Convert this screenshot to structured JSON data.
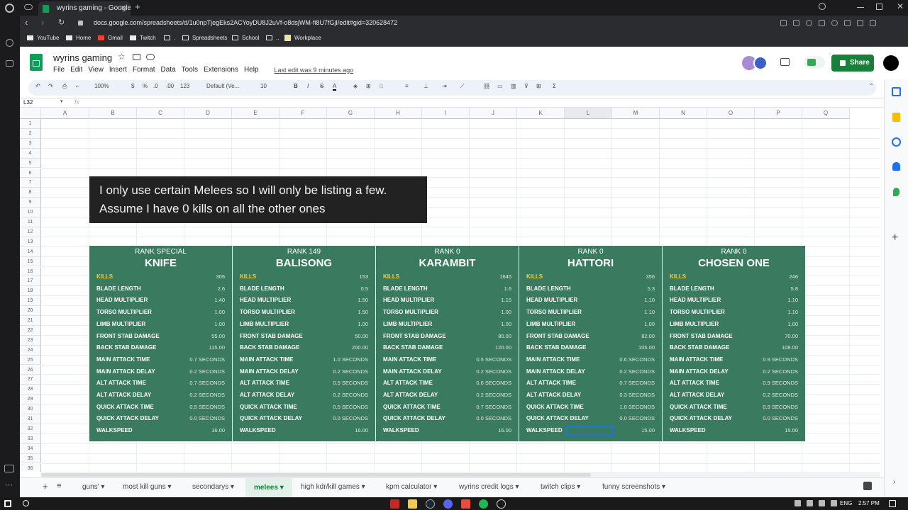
{
  "browser": {
    "tab_title": "wyrins gaming - Google Sh",
    "close_glyph": "✕",
    "new_tab_glyph": "+",
    "url": "docs.google.com/spreadsheets/d/1u0npTjegEks2ACYoyDU8J2uVf-o8dsjWM-fi8U7fGjI/edit#gid=320628472",
    "bookmarks": [
      "YouTube",
      "Home",
      "Gmail",
      "Twitch",
      ".",
      "Spreadsheets",
      "School",
      "..",
      "Workplace"
    ]
  },
  "sheets": {
    "doc_title": "wyrins gaming",
    "menus": [
      "File",
      "Edit",
      "View",
      "Insert",
      "Format",
      "Data",
      "Tools",
      "Extensions",
      "Help"
    ],
    "last_edit": "Last edit was 9 minutes ago",
    "share_label": "Share",
    "toolbar": {
      "zoom": "100%",
      "currency": "$",
      "percent": "%",
      "dec_less": ".0",
      "dec_more": ".00",
      "num_format": "123",
      "font": "Default (Ve...",
      "font_size": "10",
      "bold": "B",
      "italic": "I",
      "strike": "S",
      "text_color": "A"
    },
    "name_box": "L32",
    "fx": "fx",
    "columns": [
      "A",
      "B",
      "C",
      "D",
      "E",
      "F",
      "G",
      "H",
      "I",
      "J",
      "K",
      "L",
      "M",
      "N",
      "O",
      "P",
      "Q"
    ],
    "rows": [
      "1",
      "2",
      "3",
      "4",
      "5",
      "6",
      "7",
      "8",
      "9",
      "10",
      "11",
      "12",
      "13",
      "14",
      "15",
      "16",
      "17",
      "18",
      "19",
      "20",
      "21",
      "22",
      "23",
      "24",
      "25",
      "26",
      "27",
      "28",
      "29",
      "30",
      "31",
      "32",
      "33",
      "34",
      "35",
      "36"
    ],
    "note_line1": "I only use certain Melees so I will only be listing a few.",
    "note_line2": "Assume I have 0 kills on all the other ones",
    "sheet_tabs": [
      "guns'",
      "most kill guns",
      "secondarys",
      "melees",
      "high kdr/kill games",
      "kpm calculator",
      "wyrins credit logs",
      "twitch clips",
      "funny screenshots"
    ],
    "active_tab": "melees"
  },
  "stat_labels": [
    "KILLS",
    "BLADE LENGTH",
    "HEAD MULTIPLIER",
    "TORSO MULTIPLIER",
    "LIMB MULTIPLIER",
    "FRONT STAB DAMAGE",
    "BACK STAB DAMAGE",
    "MAIN ATTACK TIME",
    "MAIN ATTACK DELAY",
    "ALT ATTACK TIME",
    "ALT ATTACK DELAY",
    "QUICK ATTACK TIME",
    "QUICK ATTACK DELAY",
    "WALKSPEED"
  ],
  "melees": [
    {
      "rank": "RANK SPECIAL",
      "name": "KNIFE",
      "values": [
        "306",
        "2.6",
        "1.40",
        "1.00",
        "1.00",
        "55.00",
        "115.00",
        "0.7 SECONDS",
        "0.2 SECONDS",
        "0.7 SECONDS",
        "0.2 SECONDS",
        "0.5 SECONDS",
        "0.0 SECONDS",
        "16.00"
      ]
    },
    {
      "rank": "RANK 149",
      "name": "BALISONG",
      "values": [
        "153",
        "0.5",
        "1.50",
        "1.50",
        "1.00",
        "50.00",
        "200.00",
        "1.0 SECONDS",
        "0.2 SECONDS",
        "0.5 SECONDS",
        "0.2 SECONDS",
        "0.5 SECONDS",
        "0.0 SECONDS",
        "16.00"
      ]
    },
    {
      "rank": "RANK 0",
      "name": "KARAMBIT",
      "values": [
        "1645",
        "1.6",
        "1.15",
        "1.00",
        "1.00",
        "80.00",
        "120.00",
        "0.5 SECONDS",
        "0.2 SECONDS",
        "0.6 SECONDS",
        "0.2 SECONDS",
        "0.7 SECONDS",
        "0.0 SECONDS",
        "16.00"
      ]
    },
    {
      "rank": "RANK 0",
      "name": "HATTORI",
      "values": [
        "356",
        "5.3",
        "1.10",
        "1.10",
        "1.00",
        "82.00",
        "105.00",
        "0.6 SECONDS",
        "0.2 SECONDS",
        "0.7 SECONDS",
        "0.3 SECONDS",
        "1.0 SECONDS",
        "0.0 SECONDS",
        "15.00"
      ]
    },
    {
      "rank": "RANK 0",
      "name": "CHOSEN ONE",
      "values": [
        "246",
        "5.8",
        "1.10",
        "1.10",
        "1.00",
        "70.00",
        "108.00",
        "0.9 SECONDS",
        "0.2 SECONDS",
        "0.9 SECONDS",
        "0.2 SECONDS",
        "0.9 SECONDS",
        "0.0 SECONDS",
        "15.00"
      ]
    }
  ],
  "taskbar": {
    "lang": "ENG",
    "time": "2:57 PM"
  },
  "colors": {
    "card_green": "#3a7a5f",
    "kills_yellow": "#f4d03f",
    "share_green": "#188038",
    "selection_blue": "#1a73e8"
  }
}
